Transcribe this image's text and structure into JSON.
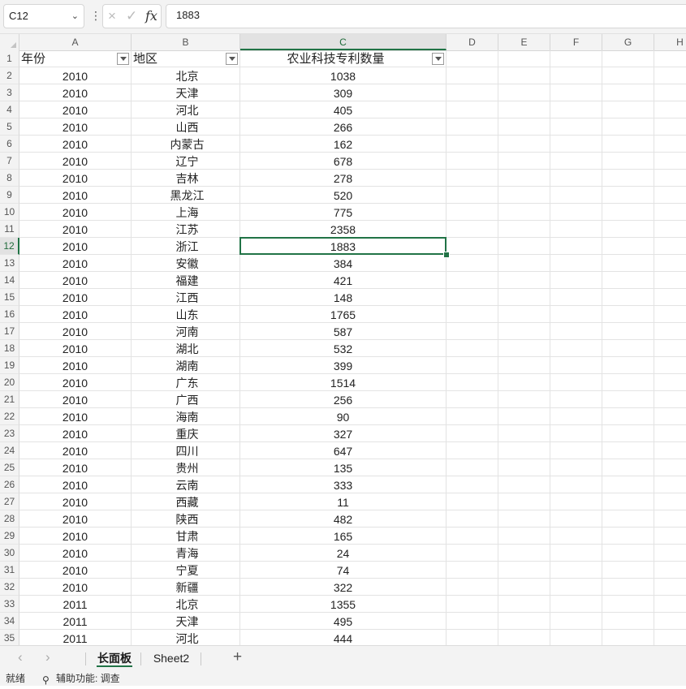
{
  "formula_bar": {
    "cell_ref": "C12",
    "formula_value": "1883",
    "cancel_icon": "×",
    "enter_icon": "✓",
    "fx_label": "fx",
    "more_icon": "⋮",
    "dropdown_icon": "chevron-down-icon"
  },
  "columns": [
    "A",
    "B",
    "C",
    "D",
    "E",
    "F",
    "G",
    "H"
  ],
  "selected_column": "C",
  "selected_row": 12,
  "table": {
    "headers": [
      "年份",
      "地区",
      "农业科技专利数量"
    ],
    "rows": [
      [
        "2010",
        "北京",
        "1038"
      ],
      [
        "2010",
        "天津",
        "309"
      ],
      [
        "2010",
        "河北",
        "405"
      ],
      [
        "2010",
        "山西",
        "266"
      ],
      [
        "2010",
        "内蒙古",
        "162"
      ],
      [
        "2010",
        "辽宁",
        "678"
      ],
      [
        "2010",
        "吉林",
        "278"
      ],
      [
        "2010",
        "黑龙江",
        "520"
      ],
      [
        "2010",
        "上海",
        "775"
      ],
      [
        "2010",
        "江苏",
        "2358"
      ],
      [
        "2010",
        "浙江",
        "1883"
      ],
      [
        "2010",
        "安徽",
        "384"
      ],
      [
        "2010",
        "福建",
        "421"
      ],
      [
        "2010",
        "江西",
        "148"
      ],
      [
        "2010",
        "山东",
        "1765"
      ],
      [
        "2010",
        "河南",
        "587"
      ],
      [
        "2010",
        "湖北",
        "532"
      ],
      [
        "2010",
        "湖南",
        "399"
      ],
      [
        "2010",
        "广东",
        "1514"
      ],
      [
        "2010",
        "广西",
        "256"
      ],
      [
        "2010",
        "海南",
        "90"
      ],
      [
        "2010",
        "重庆",
        "327"
      ],
      [
        "2010",
        "四川",
        "647"
      ],
      [
        "2010",
        "贵州",
        "135"
      ],
      [
        "2010",
        "云南",
        "333"
      ],
      [
        "2010",
        "西藏",
        "11"
      ],
      [
        "2010",
        "陕西",
        "482"
      ],
      [
        "2010",
        "甘肃",
        "165"
      ],
      [
        "2010",
        "青海",
        "24"
      ],
      [
        "2010",
        "宁夏",
        "74"
      ],
      [
        "2010",
        "新疆",
        "322"
      ],
      [
        "2011",
        "北京",
        "1355"
      ],
      [
        "2011",
        "天津",
        "495"
      ],
      [
        "2011",
        "河北",
        "444"
      ]
    ]
  },
  "sheet_tabs": {
    "prev_icon": "‹",
    "next_icon": "›",
    "tabs": [
      "长面板",
      "Sheet2"
    ],
    "active_tab": "长面板",
    "add_icon": "+"
  },
  "status_bar": {
    "ready": "就绪",
    "accessibility_icon": "⚲",
    "accessibility": "辅助功能: 调查"
  },
  "colors": {
    "accent": "#217346",
    "header_bg": "#f3f3f3",
    "grid_line": "#e3e3e3"
  }
}
